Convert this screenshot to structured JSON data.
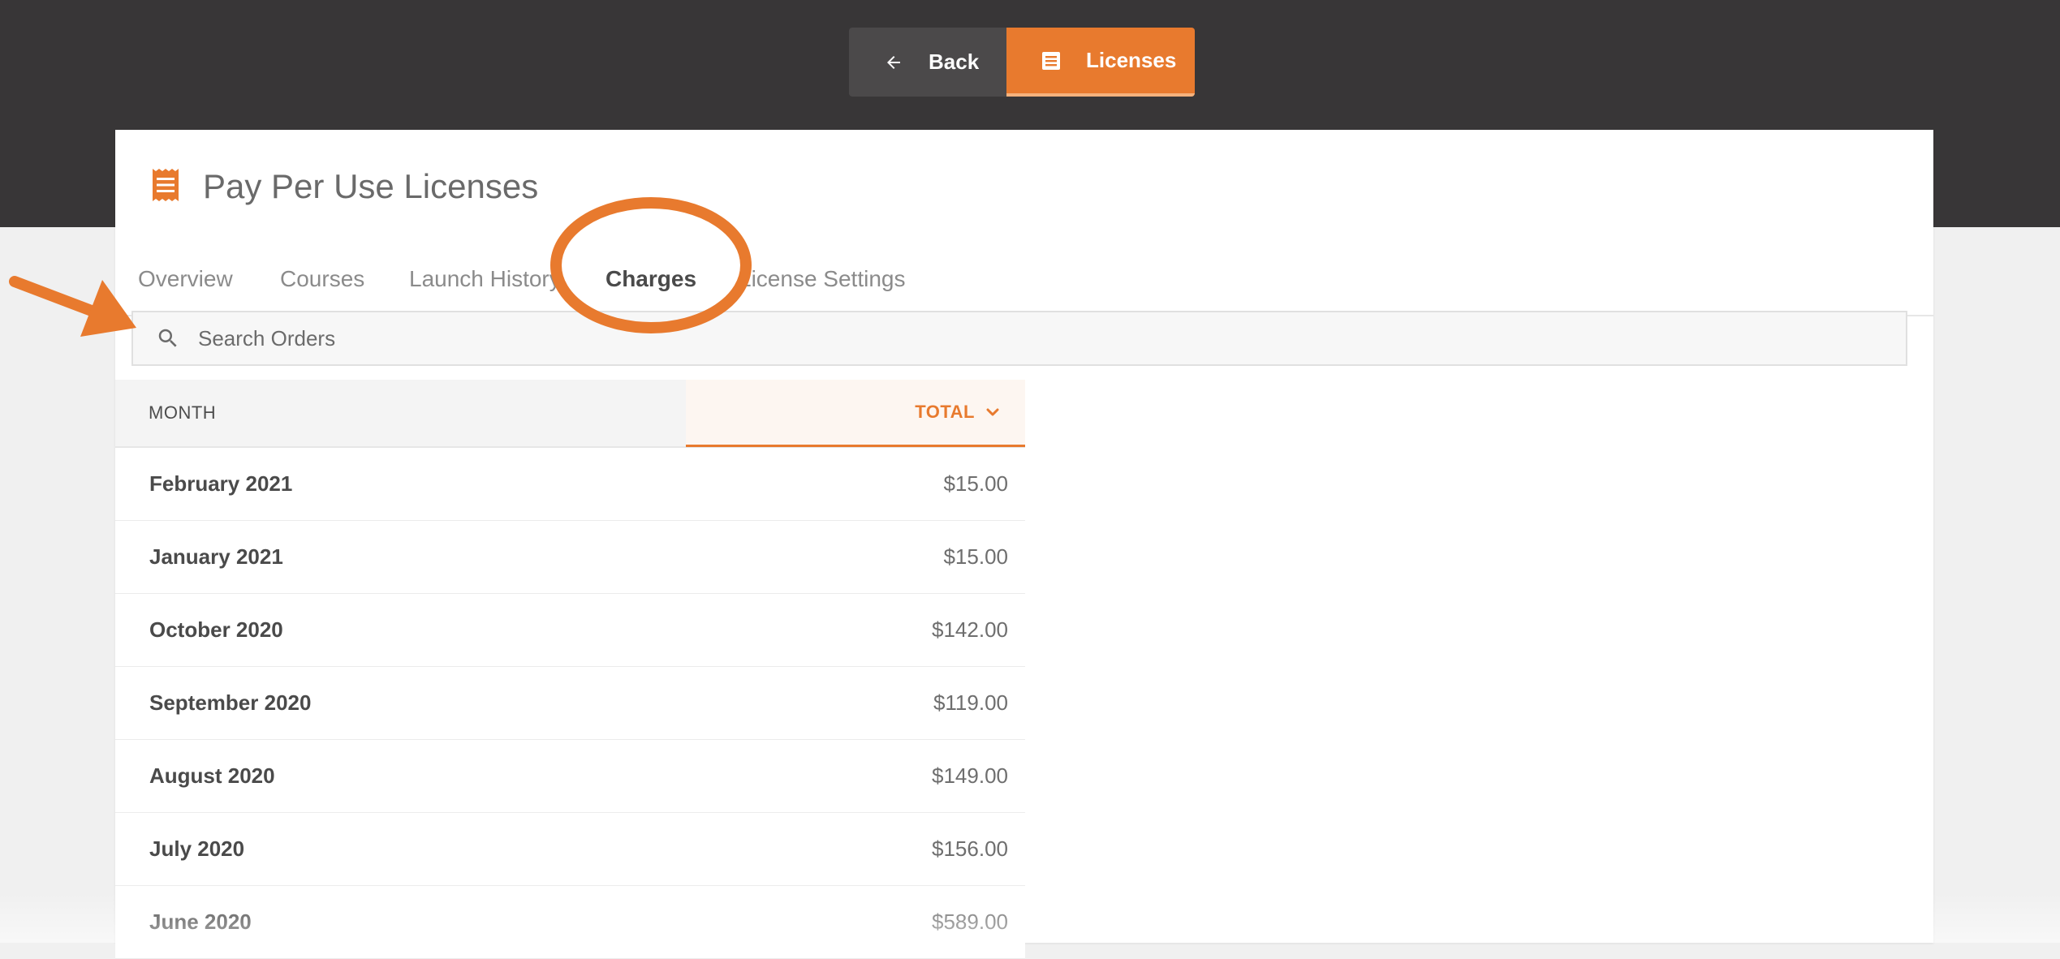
{
  "topnav": {
    "back_label": "Back",
    "licenses_label": "Licenses"
  },
  "header": {
    "title": "Pay Per Use Licenses"
  },
  "tabs": [
    {
      "label": "Overview"
    },
    {
      "label": "Courses"
    },
    {
      "label": "Launch History"
    },
    {
      "label": "Charges"
    },
    {
      "label": "License Settings"
    }
  ],
  "search": {
    "placeholder": "Search Orders"
  },
  "table": {
    "col_month": "MONTH",
    "col_total": "TOTAL",
    "sort": "descending",
    "rows": [
      {
        "month": "February 2021",
        "total": "$15.00"
      },
      {
        "month": "January 2021",
        "total": "$15.00"
      },
      {
        "month": "October 2020",
        "total": "$142.00"
      },
      {
        "month": "September 2020",
        "total": "$119.00"
      },
      {
        "month": "August 2020",
        "total": "$149.00"
      },
      {
        "month": "July 2020",
        "total": "$156.00"
      },
      {
        "month": "June 2020",
        "total": "$589.00"
      }
    ]
  },
  "colors": {
    "accent": "#e87a2e",
    "topbar": "#383637",
    "back_button": "#4b494a",
    "background": "#f0f0f0"
  },
  "icons": {
    "back": "arrow-left-icon",
    "licenses": "receipt-icon",
    "header": "receipt-icon",
    "search": "search-icon",
    "sort": "chevron-down-icon"
  }
}
